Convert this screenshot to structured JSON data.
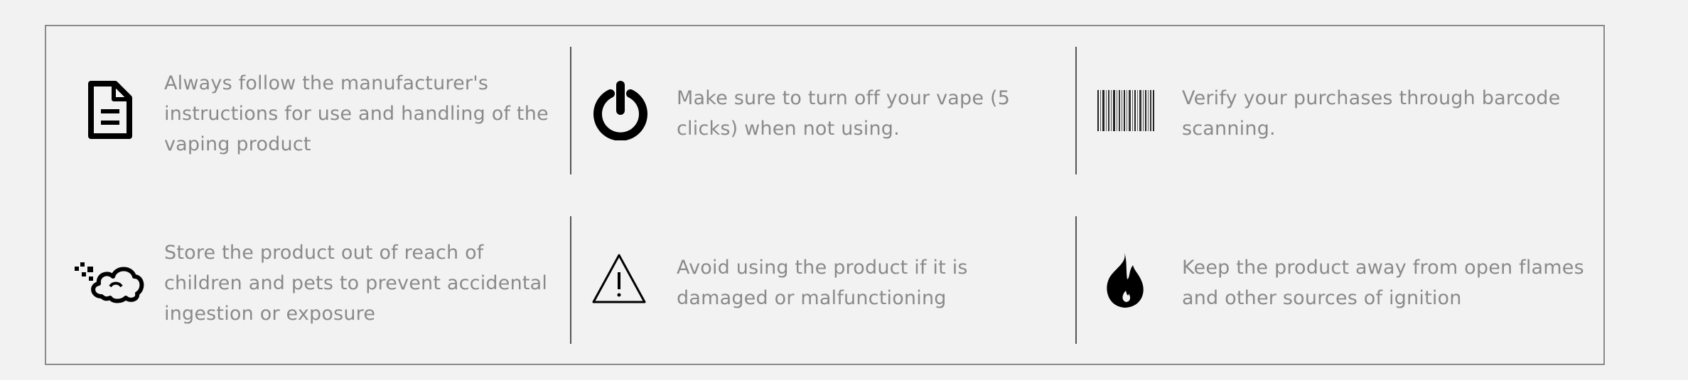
{
  "safety_tips": [
    {
      "icon": "document-icon",
      "text": "Always follow the manufacturer's instructions for use and handling of the vaping product"
    },
    {
      "icon": "power-icon",
      "text": "Make sure to turn off your vape (5 clicks) when not using."
    },
    {
      "icon": "barcode-icon",
      "text": "Verify your purchases through barcode scanning."
    },
    {
      "icon": "smoke-cloud-icon",
      "text": "Store the product out of reach of children and pets to prevent accidental ingestion or exposure"
    },
    {
      "icon": "warning-icon",
      "text": "Avoid using the product if it is damaged or malfunctioning"
    },
    {
      "icon": "flame-icon",
      "text": "Keep the product away from open flames and other sources of ignition"
    }
  ]
}
